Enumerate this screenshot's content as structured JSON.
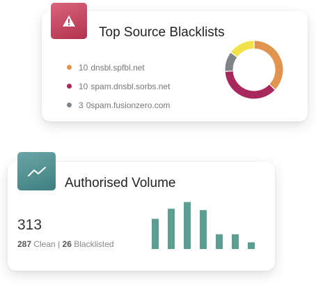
{
  "blacklists_card": {
    "title": "Top Source Blacklists",
    "icon": "warning-icon",
    "icon_color": "#c1435f",
    "items": [
      {
        "count": "10",
        "name": "dnsbl.spfbl.net",
        "color": "#e0944f",
        "share": 10
      },
      {
        "count": "10",
        "name": "spam.dnsbl.sorbs.net",
        "color": "#a8285d",
        "share": 10
      },
      {
        "count": "3",
        "name": "0spam.fusionzero.com",
        "color": "#7e8487",
        "share": 3
      }
    ],
    "donut_extra_segment": {
      "color": "#f2e24a",
      "share": 4
    }
  },
  "volume_card": {
    "title": "Authorised Volume",
    "icon": "trend-up-icon",
    "icon_color": "#4f8e8f",
    "total": "313",
    "clean_count": "287",
    "clean_label": "Clean",
    "separator": "|",
    "blacklisted_count": "26",
    "blacklisted_label": "Blacklisted",
    "bar_color": "#5d9e93",
    "bar_values": [
      45,
      60,
      70,
      58,
      22,
      22,
      10
    ]
  }
}
